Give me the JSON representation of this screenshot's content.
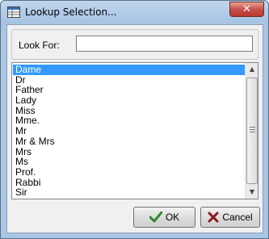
{
  "window": {
    "title": "Lookup Selection...",
    "app_icon": "grid-window-icon",
    "close_icon": "close-icon",
    "close_label": "✕"
  },
  "search": {
    "label": "Look For:",
    "value": "",
    "placeholder": ""
  },
  "list": {
    "items": [
      "Dame",
      "Dr",
      "Father",
      "Lady",
      "Miss",
      "Mme.",
      "Mr",
      "Mr & Mrs",
      "Mrs",
      "Ms",
      "Prof.",
      "Rabbi",
      "Sir"
    ],
    "selected": "Dame"
  },
  "buttons": {
    "ok_label": "OK",
    "ok_icon": "checkmark-icon",
    "cancel_label": "Cancel",
    "cancel_icon": "x-icon"
  },
  "colors": {
    "selection": "#3399ff",
    "ok_icon": "#2e8b2e",
    "cancel_icon": "#8b1a1a",
    "close_button": "#c75050"
  }
}
